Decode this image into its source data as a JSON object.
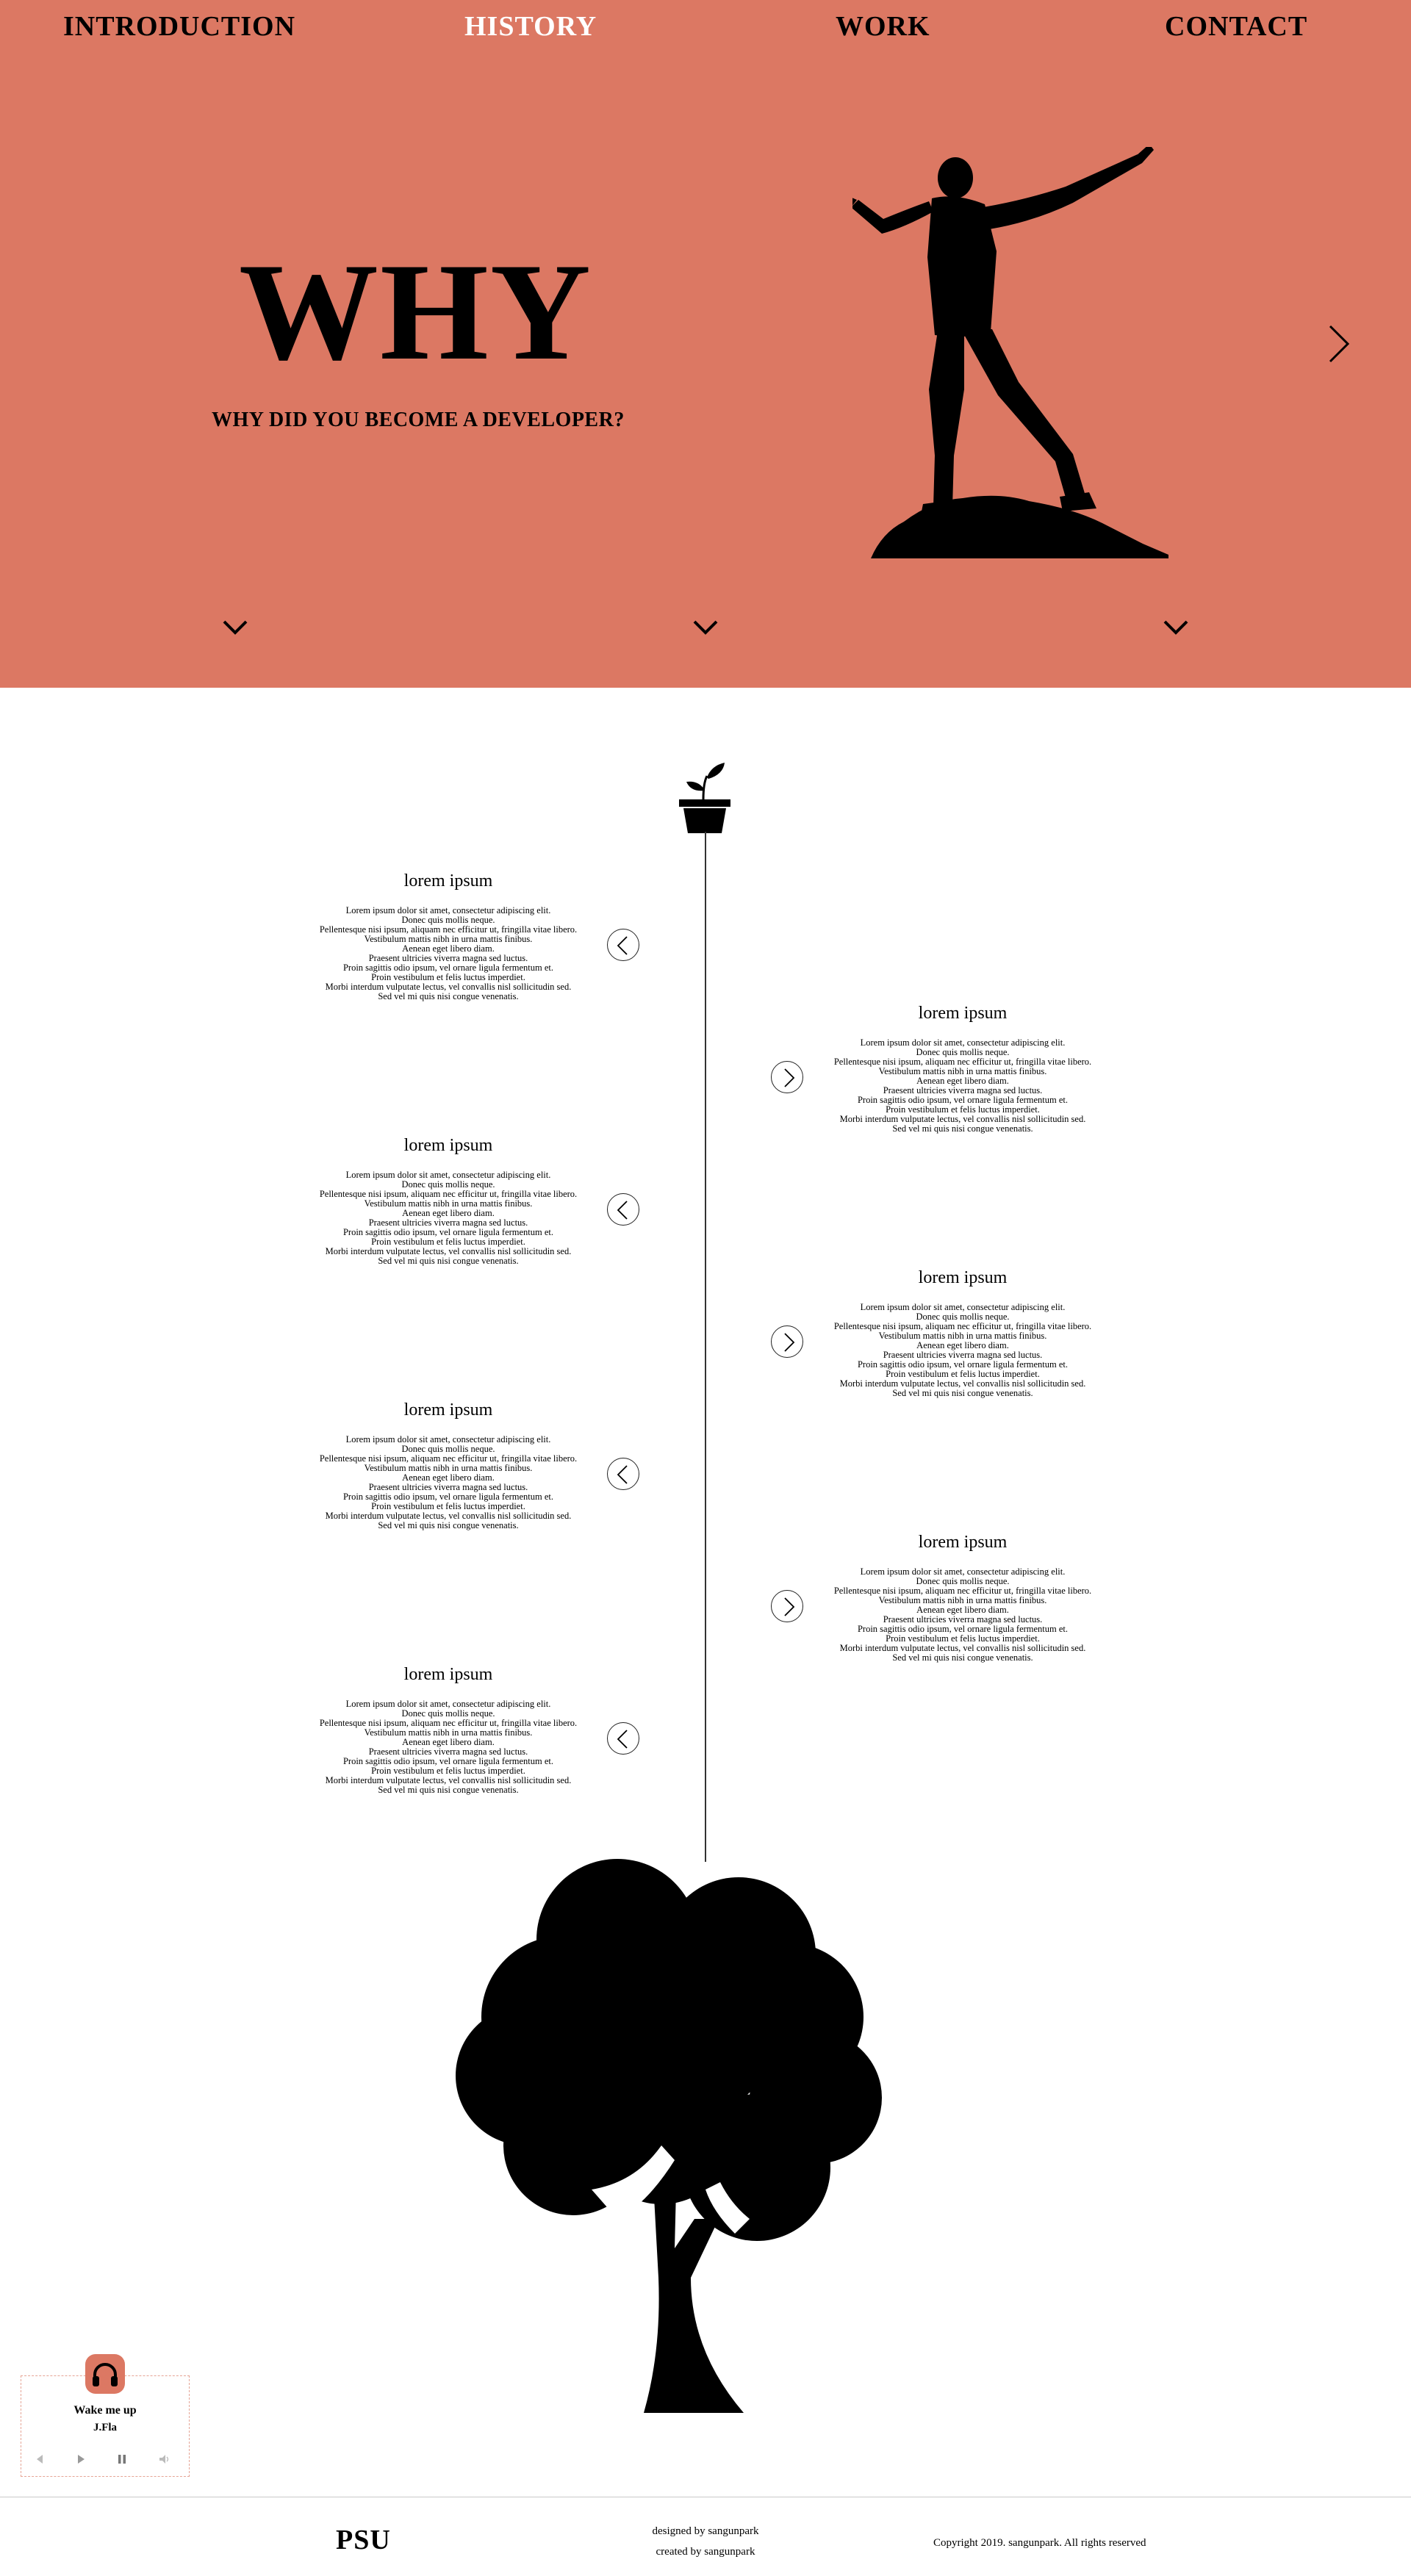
{
  "nav": {
    "items": [
      {
        "label": "INTRODUCTION",
        "active": false
      },
      {
        "label": "HISTORY",
        "active": true
      },
      {
        "label": "WORK",
        "active": false
      },
      {
        "label": "CONTACT",
        "active": false
      }
    ]
  },
  "hero": {
    "title": "WHY",
    "subtitle": "WHY DID YOU BECOME A DEVELOPER?",
    "background_color": "#dc7863",
    "next_icon": "chevron-right-icon",
    "scroll_icon": "chevron-down-icon"
  },
  "timeline": {
    "top_icon": "plant-pot-icon",
    "bottom_image": "tree-silhouette",
    "entries": [
      {
        "side": "left",
        "title": "lorem ipsum",
        "button_icon": "chevron-left-icon",
        "lines": [
          "Lorem ipsum dolor sit amet, consectetur adipiscing elit.",
          "Donec quis mollis neque.",
          "Pellentesque nisi ipsum, aliquam nec efficitur ut, fringilla vitae libero.",
          "Vestibulum mattis nibh in urna mattis finibus.",
          "Aenean eget libero diam.",
          "Praesent ultricies viverra magna sed luctus.",
          "Proin sagittis odio ipsum, vel ornare ligula fermentum et.",
          "Proin vestibulum et felis luctus imperdiet.",
          "Morbi interdum vulputate lectus, vel convallis nisl sollicitudin sed.",
          "Sed vel mi quis nisi congue venenatis."
        ]
      },
      {
        "side": "right",
        "title": "lorem ipsum",
        "button_icon": "chevron-right-icon",
        "lines": [
          "Lorem ipsum dolor sit amet, consectetur adipiscing elit.",
          "Donec quis mollis neque.",
          "Pellentesque nisi ipsum, aliquam nec efficitur ut, fringilla vitae libero.",
          "Vestibulum mattis nibh in urna mattis finibus.",
          "Aenean eget libero diam.",
          "Praesent ultricies viverra magna sed luctus.",
          "Proin sagittis odio ipsum, vel ornare ligula fermentum et.",
          "Proin vestibulum et felis luctus imperdiet.",
          "Morbi interdum vulputate lectus, vel convallis nisl sollicitudin sed.",
          "Sed vel mi quis nisi congue venenatis."
        ]
      },
      {
        "side": "left",
        "title": "lorem ipsum",
        "button_icon": "chevron-left-icon",
        "lines": [
          "Lorem ipsum dolor sit amet, consectetur adipiscing elit.",
          "Donec quis mollis neque.",
          "Pellentesque nisi ipsum, aliquam nec efficitur ut, fringilla vitae libero.",
          "Vestibulum mattis nibh in urna mattis finibus.",
          "Aenean eget libero diam.",
          "Praesent ultricies viverra magna sed luctus.",
          "Proin sagittis odio ipsum, vel ornare ligula fermentum et.",
          "Proin vestibulum et felis luctus imperdiet.",
          "Morbi interdum vulputate lectus, vel convallis nisl sollicitudin sed.",
          "Sed vel mi quis nisi congue venenatis."
        ]
      },
      {
        "side": "right",
        "title": "lorem ipsum",
        "button_icon": "chevron-right-icon",
        "lines": [
          "Lorem ipsum dolor sit amet, consectetur adipiscing elit.",
          "Donec quis mollis neque.",
          "Pellentesque nisi ipsum, aliquam nec efficitur ut, fringilla vitae libero.",
          "Vestibulum mattis nibh in urna mattis finibus.",
          "Aenean eget libero diam.",
          "Praesent ultricies viverra magna sed luctus.",
          "Proin sagittis odio ipsum, vel ornare ligula fermentum et.",
          "Proin vestibulum et felis luctus imperdiet.",
          "Morbi interdum vulputate lectus, vel convallis nisl sollicitudin sed.",
          "Sed vel mi quis nisi congue venenatis."
        ]
      },
      {
        "side": "left",
        "title": "lorem ipsum",
        "button_icon": "chevron-left-icon",
        "lines": [
          "Lorem ipsum dolor sit amet, consectetur adipiscing elit.",
          "Donec quis mollis neque.",
          "Pellentesque nisi ipsum, aliquam nec efficitur ut, fringilla vitae libero.",
          "Vestibulum mattis nibh in urna mattis finibus.",
          "Aenean eget libero diam.",
          "Praesent ultricies viverra magna sed luctus.",
          "Proin sagittis odio ipsum, vel ornare ligula fermentum et.",
          "Proin vestibulum et felis luctus imperdiet.",
          "Morbi interdum vulputate lectus, vel convallis nisl sollicitudin sed.",
          "Sed vel mi quis nisi congue venenatis."
        ]
      },
      {
        "side": "right",
        "title": "lorem ipsum",
        "button_icon": "chevron-right-icon",
        "lines": [
          "Lorem ipsum dolor sit amet, consectetur adipiscing elit.",
          "Donec quis mollis neque.",
          "Pellentesque nisi ipsum, aliquam nec efficitur ut, fringilla vitae libero.",
          "Vestibulum mattis nibh in urna mattis finibus.",
          "Aenean eget libero diam.",
          "Praesent ultricies viverra magna sed luctus.",
          "Proin sagittis odio ipsum, vel ornare ligula fermentum et.",
          "Proin vestibulum et felis luctus imperdiet.",
          "Morbi interdum vulputate lectus, vel convallis nisl sollicitudin sed.",
          "Sed vel mi quis nisi congue venenatis."
        ]
      },
      {
        "side": "left",
        "title": "lorem ipsum",
        "button_icon": "chevron-left-icon",
        "lines": [
          "Lorem ipsum dolor sit amet, consectetur adipiscing elit.",
          "Donec quis mollis neque.",
          "Pellentesque nisi ipsum, aliquam nec efficitur ut, fringilla vitae libero.",
          "Vestibulum mattis nibh in urna mattis finibus.",
          "Aenean eget libero diam.",
          "Praesent ultricies viverra magna sed luctus.",
          "Proin sagittis odio ipsum, vel ornare ligula fermentum et.",
          "Proin vestibulum et felis luctus imperdiet.",
          "Morbi interdum vulputate lectus, vel convallis nisl sollicitudin sed.",
          "Sed vel mi quis nisi congue venenatis."
        ]
      }
    ]
  },
  "player": {
    "icon": "headphones-icon",
    "title": "Wake me up",
    "artist": "J.Fla",
    "controls": [
      "previous-icon",
      "play-icon",
      "pause-icon",
      "volume-icon"
    ]
  },
  "footer": {
    "logo": "PSU",
    "designed_by": "designed by sangunpark",
    "created_by": "created by sangunpark",
    "copyright": "Copyright 2019. sangunpark. All rights reserved"
  }
}
